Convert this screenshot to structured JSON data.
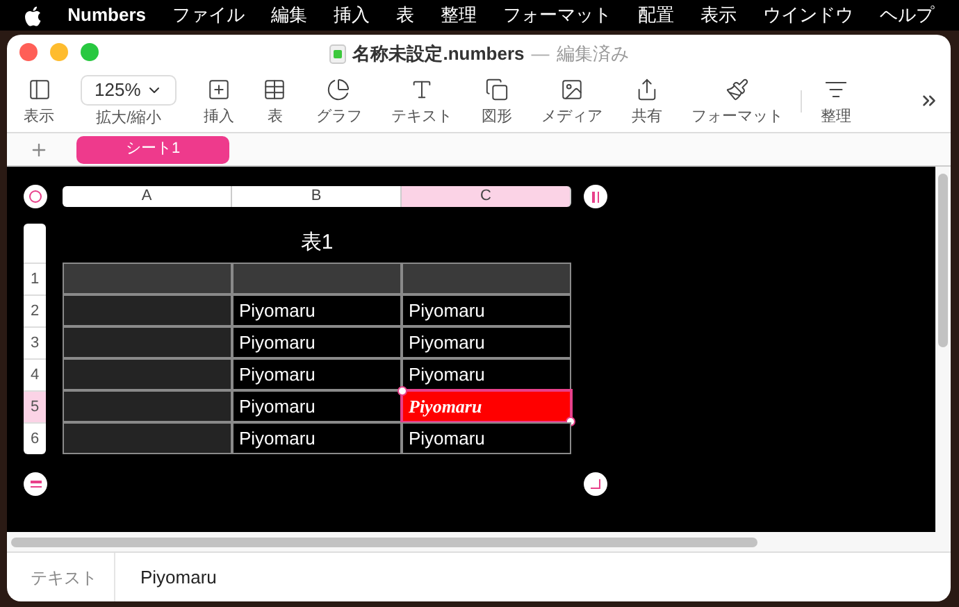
{
  "menubar": {
    "app": "Numbers",
    "items": [
      "ファイル",
      "編集",
      "挿入",
      "表",
      "整理",
      "フォーマット",
      "配置",
      "表示",
      "ウインドウ",
      "ヘルプ"
    ]
  },
  "window": {
    "title": "名称未設定.numbers",
    "separator": "—",
    "status": "編集済み"
  },
  "toolbar": [
    {
      "kind": "button",
      "label": "表示"
    },
    {
      "kind": "dropdown",
      "label": "拡大/縮小",
      "value": "125%"
    },
    {
      "kind": "button",
      "label": "挿入"
    },
    {
      "kind": "button",
      "label": "表"
    },
    {
      "kind": "button",
      "label": "グラフ"
    },
    {
      "kind": "button",
      "label": "テキスト"
    },
    {
      "kind": "button",
      "label": "図形"
    },
    {
      "kind": "button",
      "label": "メディア"
    },
    {
      "kind": "button",
      "label": "共有"
    },
    {
      "kind": "button",
      "label": "フォーマット"
    },
    {
      "kind": "button",
      "label": "整理"
    }
  ],
  "sheet_tabs": [
    {
      "label": "シート1",
      "selected": true
    }
  ],
  "table": {
    "title": "表1",
    "columns": [
      {
        "label": "A",
        "selected": false
      },
      {
        "label": "B",
        "selected": false
      },
      {
        "label": "C",
        "selected": true
      }
    ],
    "rows": [
      {
        "label": "1",
        "selected": false,
        "cells": [
          {
            "kind": "header",
            "selected": false
          },
          {
            "kind": "header",
            "selected": false
          },
          {
            "kind": "header",
            "selected": false
          }
        ]
      },
      {
        "label": "2",
        "selected": false,
        "cells": [
          {
            "kind": "header",
            "selected": false
          },
          {
            "kind": "plain",
            "text": "Piyomaru",
            "selected": false
          },
          {
            "kind": "plain",
            "text": "Piyomaru",
            "selected": false
          }
        ]
      },
      {
        "label": "3",
        "selected": false,
        "cells": [
          {
            "kind": "header",
            "selected": false
          },
          {
            "kind": "plain",
            "text": "Piyomaru",
            "selected": false
          },
          {
            "kind": "plain",
            "text": "Piyomaru",
            "selected": false
          }
        ]
      },
      {
        "label": "4",
        "selected": false,
        "cells": [
          {
            "kind": "header",
            "selected": false
          },
          {
            "kind": "plain",
            "text": "Piyomaru",
            "selected": false
          },
          {
            "kind": "plain",
            "text": "Piyomaru",
            "selected": false
          }
        ]
      },
      {
        "label": "5",
        "selected": true,
        "cells": [
          {
            "kind": "header",
            "selected": false
          },
          {
            "kind": "plain",
            "text": "Piyomaru",
            "selected": false
          },
          {
            "kind": "styled",
            "text": "Piyomaru",
            "selected": true
          }
        ]
      },
      {
        "label": "6",
        "selected": false,
        "cells": [
          {
            "kind": "header",
            "selected": false
          },
          {
            "kind": "plain",
            "text": "Piyomaru",
            "selected": false
          },
          {
            "kind": "plain",
            "text": "Piyomaru",
            "selected": false
          }
        ]
      }
    ]
  },
  "format_bar": {
    "label": "テキスト",
    "value": "Piyomaru"
  }
}
